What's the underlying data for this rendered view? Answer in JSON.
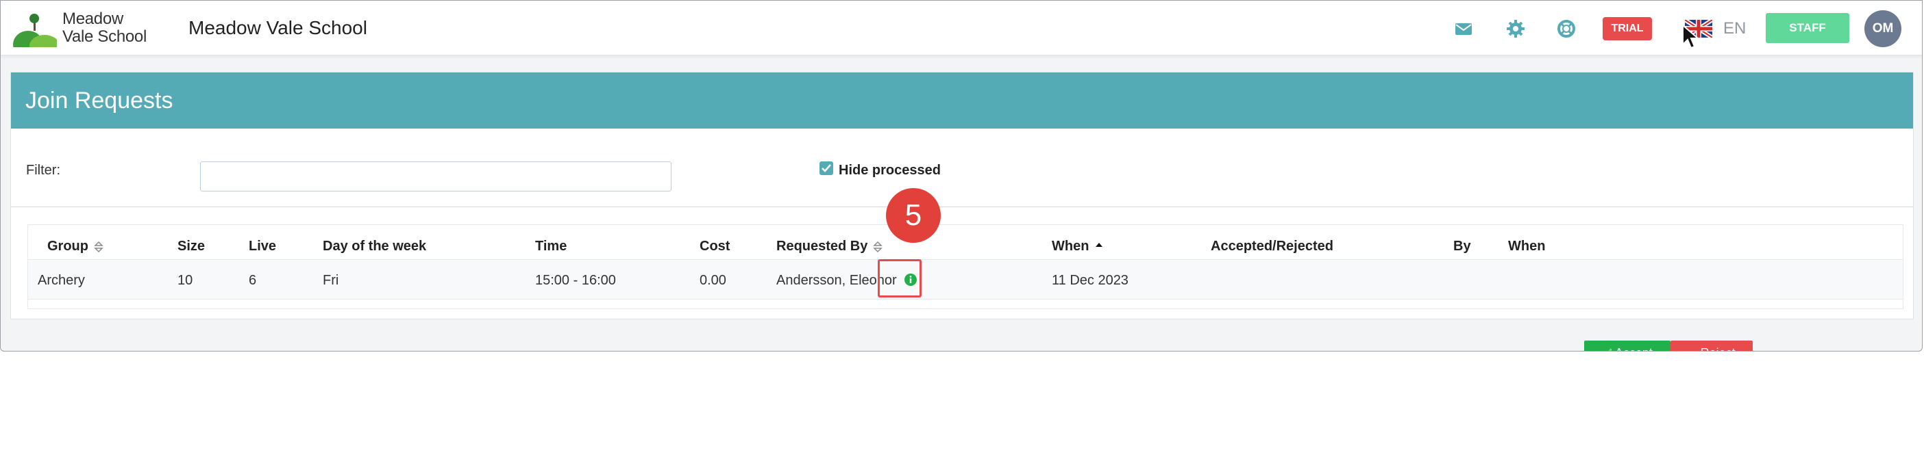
{
  "header": {
    "logo_line1": "Meadow",
    "logo_line2": "Vale School",
    "school_name": "Meadow Vale School",
    "trial_label": "TRIAL",
    "language": "EN",
    "staff_label": "STAFF",
    "avatar_initials": "OM",
    "icons": [
      "mail-icon",
      "gear-icon",
      "help-lifebuoy-icon",
      "uk-flag-icon"
    ],
    "accent_color": "#55abb5"
  },
  "page": {
    "title": "Join Requests",
    "filter_label": "Filter:",
    "filter_value": "",
    "filter_placeholder": "",
    "hide_processed_label": "Hide processed",
    "hide_processed_checked": true
  },
  "table": {
    "columns": {
      "group": "Group",
      "size": "Size",
      "live": "Live",
      "day": "Day of the week",
      "time": "Time",
      "cost": "Cost",
      "requested_by": "Requested By",
      "when": "When",
      "accepted_rejected": "Accepted/Rejected",
      "by": "By",
      "when2": "When"
    },
    "rows": [
      {
        "group": "Archery",
        "size": "10",
        "live": "6",
        "day": "Fri",
        "time": "15:00 - 16:00",
        "cost": "0.00",
        "requested_by": "Andersson, Eleonor",
        "when": "11 Dec 2023",
        "accepted_rejected": "",
        "by": "",
        "when2": "",
        "accept_label": "Accept",
        "reject_label": "Reject"
      }
    ]
  },
  "annotation": {
    "step_number": "5"
  }
}
